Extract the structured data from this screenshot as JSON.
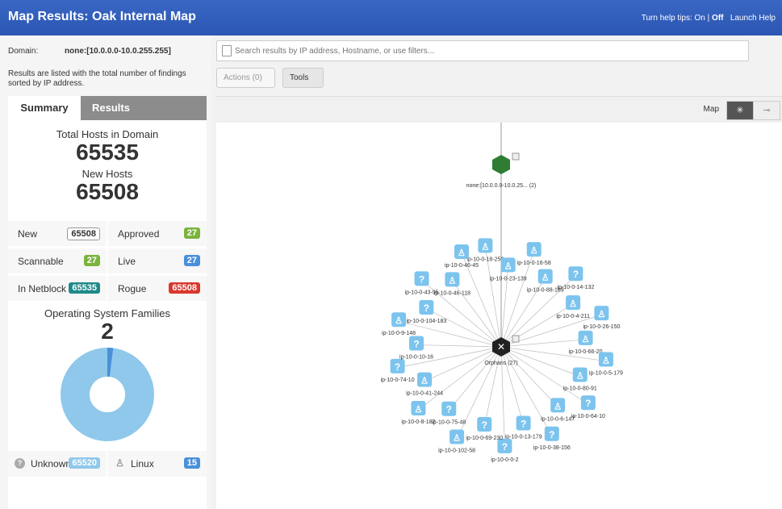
{
  "header": {
    "title": "Map Results: Oak Internal Map",
    "help_tips_prefix": "Turn help tips:",
    "help_on": "On",
    "help_sep": "|",
    "help_off": "Off",
    "launch_help": "Launch Help"
  },
  "left": {
    "domain_label": "Domain:",
    "domain_value": "none:[10.0.0.0-10.0.255.255]",
    "description": "Results are listed with the total number of findings sorted by IP address.",
    "tabs": {
      "summary": "Summary",
      "results": "Results"
    },
    "total_hosts_label": "Total Hosts in Domain",
    "total_hosts": "65535",
    "new_hosts_label": "New Hosts",
    "new_hosts": "65508",
    "stats": [
      {
        "label": "New",
        "value": "65508",
        "style": "outline"
      },
      {
        "label": "Approved",
        "value": "27",
        "style": "green"
      },
      {
        "label": "Scannable",
        "value": "27",
        "style": "green"
      },
      {
        "label": "Live",
        "value": "27",
        "style": "blue"
      },
      {
        "label": "In Netblock",
        "value": "65535",
        "style": "teal"
      },
      {
        "label": "Rogue",
        "value": "65508",
        "style": "red"
      }
    ],
    "os_label": "Operating System Families",
    "os_count": "2",
    "os_legend": [
      {
        "label": "Unknown",
        "value": "65520",
        "icon": "question-icon",
        "color": "#7fbfe6"
      },
      {
        "label": "Linux",
        "value": "15",
        "icon": "linux-icon",
        "color": "#4a90d9"
      }
    ],
    "donut": {
      "unknown": 65520,
      "linux": 15
    }
  },
  "toolbar": {
    "search_placeholder": "Search results by IP address, Hostname, or use filters...",
    "actions_label": "Actions (0)",
    "tools_label": "Tools"
  },
  "map": {
    "view_label": "Map",
    "root_label": "none:[10.0.0.0-10.0.25... (2)",
    "orphans_label": "Orphans (27)",
    "nodes": [
      {
        "label": "ip-10-0-18-250",
        "type": "linux"
      },
      {
        "label": "ip-10-0-23-139",
        "type": "linux"
      },
      {
        "label": "ip-10-0-16-58",
        "type": "linux"
      },
      {
        "label": "ip-10-0-88-169",
        "type": "linux"
      },
      {
        "label": "ip-10-0-14-132",
        "type": "unknown"
      },
      {
        "label": "ip-10-0-4-211",
        "type": "linux"
      },
      {
        "label": "ip-10-0-26-150",
        "type": "linux"
      },
      {
        "label": "ip-10-0-66-20",
        "type": "linux"
      },
      {
        "label": "ip-10-0-5-179",
        "type": "linux"
      },
      {
        "label": "ip-10-0-80-91",
        "type": "linux"
      },
      {
        "label": "ip-10-0-64-10",
        "type": "unknown"
      },
      {
        "label": "ip-10-0-6-147",
        "type": "linux"
      },
      {
        "label": "ip-10-0-38-156",
        "type": "unknown"
      },
      {
        "label": "ip-10-0-13-179",
        "type": "unknown"
      },
      {
        "label": "ip-10-0-0-2",
        "type": "unknown"
      },
      {
        "label": "ip-10-0-69-230",
        "type": "unknown"
      },
      {
        "label": "ip-10-0-102-58",
        "type": "linux"
      },
      {
        "label": "ip-10-0-75-48",
        "type": "unknown"
      },
      {
        "label": "ip-10-0-8-182",
        "type": "linux"
      },
      {
        "label": "ip-10-0-41-244",
        "type": "linux"
      },
      {
        "label": "ip-10-0-74-10",
        "type": "unknown"
      },
      {
        "label": "ip-10-0-10-16",
        "type": "unknown"
      },
      {
        "label": "ip-10-0-9-148",
        "type": "linux"
      },
      {
        "label": "ip-10-0-104-183",
        "type": "unknown"
      },
      {
        "label": "ip-10-0-43-95",
        "type": "unknown"
      },
      {
        "label": "ip-10-0-46-118",
        "type": "linux"
      },
      {
        "label": "ip-10-0-46-45",
        "type": "linux"
      }
    ]
  }
}
